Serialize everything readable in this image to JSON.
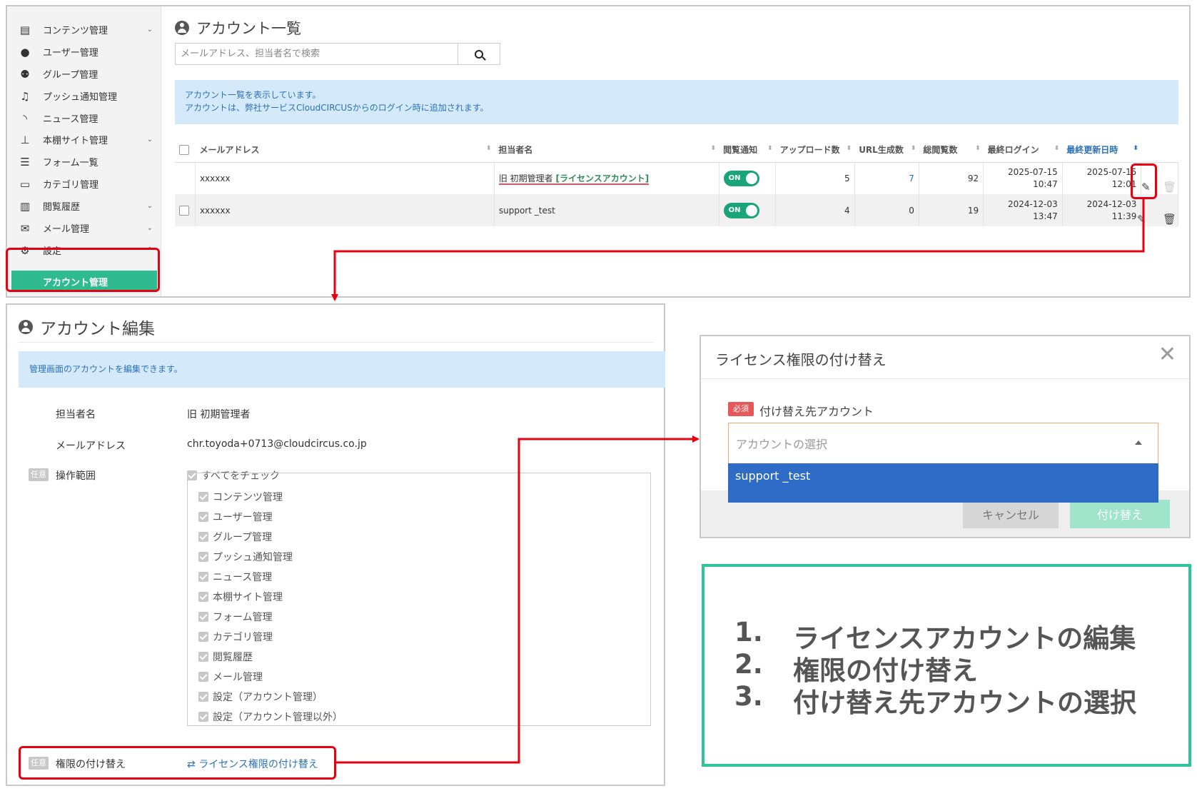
{
  "sidebar": {
    "items": [
      {
        "label": "コンテンツ管理",
        "icon": "content-icon",
        "chevron": true
      },
      {
        "label": "ユーザー管理",
        "icon": "user-icon",
        "chevron": false
      },
      {
        "label": "グループ管理",
        "icon": "users-icon",
        "chevron": false
      },
      {
        "label": "プッシュ通知管理",
        "icon": "bell-icon",
        "chevron": false
      },
      {
        "label": "ニュース管理",
        "icon": "rss-icon",
        "chevron": false
      },
      {
        "label": "本棚サイト管理",
        "icon": "sitemap-icon",
        "chevron": true
      },
      {
        "label": "フォーム一覧",
        "icon": "form-icon",
        "chevron": false
      },
      {
        "label": "カテゴリ管理",
        "icon": "folder-icon",
        "chevron": false
      },
      {
        "label": "閲覧履歴",
        "icon": "chart-icon",
        "chevron": true
      },
      {
        "label": "メール管理",
        "icon": "mail-icon",
        "chevron": true
      },
      {
        "label": "設定",
        "icon": "gear-icon",
        "chevron": true
      }
    ],
    "sub_item": "アカウント管理"
  },
  "list": {
    "title": "アカウント一覧",
    "search_placeholder": "メールアドレス、担当者名で検索",
    "info_line1": "アカウント一覧を表示しています。",
    "info_line2": "アカウントは、弊社サービスCloudCIRCUSからのログイン時に追加されます。",
    "headers": [
      "メールアドレス",
      "担当者名",
      "閲覧通知",
      "アップロード数",
      "URL生成数",
      "総閲覧数",
      "最終ログイン",
      "最終更新日時"
    ],
    "rows": [
      {
        "email": "xxxxxx",
        "name": "旧 初期管理者",
        "license": "[ライセンスアカウント]",
        "toggle": "ON",
        "uploads": "5",
        "urls": "7",
        "views": "92",
        "login_date": "2025-07-15",
        "login_time": "10:47",
        "updated_date": "2025-07-15",
        "updated_time": "12:01"
      },
      {
        "email": "xxxxxx",
        "name": "support _test",
        "license": "",
        "toggle": "ON",
        "uploads": "4",
        "urls": "0",
        "views": "19",
        "login_date": "2024-12-03",
        "login_time": "13:47",
        "updated_date": "2024-12-03",
        "updated_time": "11:39"
      }
    ]
  },
  "edit": {
    "title": "アカウント編集",
    "info": "管理画面のアカウントを編集できます。",
    "name_label": "担当者名",
    "name_value": "旧 初期管理者",
    "email_label": "メールアドレス",
    "email_value": "chr.toyoda+0713@cloudcircus.co.jp",
    "optional_badge": "任意",
    "scope_label": "操作範囲",
    "check_all": "すべてをチェック",
    "permissions": [
      "コンテンツ管理",
      "ユーザー管理",
      "グループ管理",
      "プッシュ通知管理",
      "ニュース管理",
      "本棚サイト管理",
      "フォーム管理",
      "カテゴリ管理",
      "閲覧履歴",
      "メール管理",
      "設定（アカウント管理）",
      "設定（アカウント管理以外）"
    ],
    "swap_label": "権限の付け替え",
    "swap_link": "ライセンス権限の付け替え"
  },
  "modal": {
    "title": "ライセンス権限の付け替え",
    "close": "✕",
    "required_badge": "必須",
    "field_label": "付け替え先アカウント",
    "select_placeholder": "アカウントの選択",
    "option": "support _test",
    "cancel": "キャンセル",
    "submit": "付け替え"
  },
  "steps": [
    {
      "num": "1.",
      "text": "ライセンスアカウントの編集"
    },
    {
      "num": "2.",
      "text": "権限の付け替え"
    },
    {
      "num": "3.",
      "text": "付け替え先アカウントの選択"
    }
  ],
  "colors": {
    "accent": "#2fba8f",
    "highlight": "#e60012",
    "info_bg": "#d4e9f9",
    "link": "#2d72b8",
    "note_border": "#2fc59b"
  }
}
